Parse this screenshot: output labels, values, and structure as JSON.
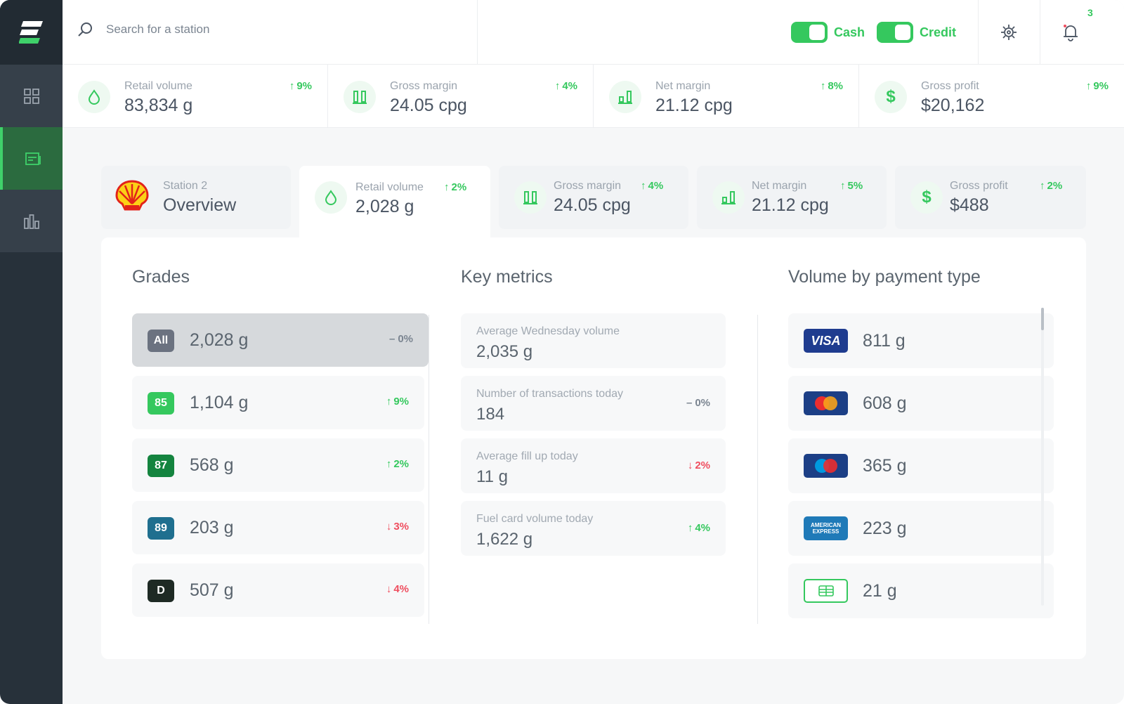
{
  "header": {
    "search_placeholder": "Search for a station",
    "toggles": [
      {
        "label": "Cash",
        "on": true
      },
      {
        "label": "Credit",
        "on": true
      }
    ],
    "notification_count": "3"
  },
  "top_kpis": [
    {
      "label": "Retail volume",
      "value": "83,834 g",
      "change": "9%",
      "icon": "drop-icon"
    },
    {
      "label": "Gross margin",
      "value": "24.05 cpg",
      "change": "4%",
      "icon": "bars-icon"
    },
    {
      "label": "Net margin",
      "value": "21.12 cpg",
      "change": "8%",
      "icon": "chart-icon"
    },
    {
      "label": "Gross profit",
      "value": "$20,162",
      "change": "9%",
      "icon": "dollar-icon"
    }
  ],
  "station": {
    "name": "Station 2",
    "view": "Overview",
    "kpis": [
      {
        "label": "Retail volume",
        "value": "2,028 g",
        "change": "2%"
      },
      {
        "label": "Gross margin",
        "value": "24.05 cpg",
        "change": "4%"
      },
      {
        "label": "Net margin",
        "value": "21.12 cpg",
        "change": "5%"
      },
      {
        "label": "Gross profit",
        "value": "$488",
        "change": "2%"
      }
    ]
  },
  "grades": {
    "title": "Grades",
    "rows": [
      {
        "badge": "All",
        "value": "2,028 g",
        "change": "0%",
        "trend": "flat",
        "color": "#6b7280"
      },
      {
        "badge": "85",
        "value": "1,104 g",
        "change": "9%",
        "trend": "up",
        "color": "#35c85e"
      },
      {
        "badge": "87",
        "value": "568 g",
        "change": "2%",
        "trend": "up",
        "color": "#14843f"
      },
      {
        "badge": "89",
        "value": "203 g",
        "change": "3%",
        "trend": "down",
        "color": "#1f6f8f"
      },
      {
        "badge": "D",
        "value": "507 g",
        "change": "4%",
        "trend": "down",
        "color": "#1e2a24"
      }
    ]
  },
  "key_metrics": {
    "title": "Key metrics",
    "rows": [
      {
        "label": "Average Wednesday volume",
        "value": "2,035 g",
        "change": "",
        "trend": ""
      },
      {
        "label": "Number of transactions today",
        "value": "184",
        "change": "0%",
        "trend": "flat"
      },
      {
        "label": "Average fill up today",
        "value": "11 g",
        "change": "2%",
        "trend": "down"
      },
      {
        "label": "Fuel card volume today",
        "value": "1,622 g",
        "change": "4%",
        "trend": "up"
      }
    ]
  },
  "payment": {
    "title": "Volume by payment type",
    "rows": [
      {
        "card": "VISA",
        "value": "811 g"
      },
      {
        "card": "MasterCard",
        "value": "608 g"
      },
      {
        "card": "Maestro",
        "value": "365 g"
      },
      {
        "card": "AMERICAN EXPRESS",
        "value": "223 g"
      },
      {
        "card": "cash",
        "value": "21 g"
      }
    ]
  }
}
